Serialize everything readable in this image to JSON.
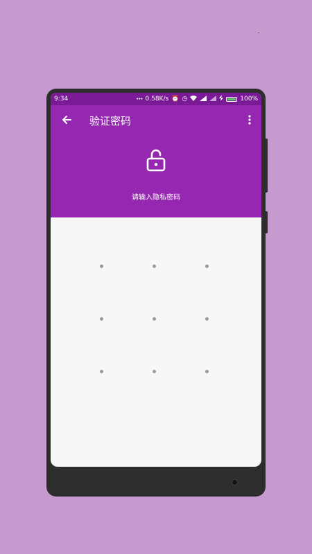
{
  "status_bar": {
    "time": "9:34",
    "net_speed": "0.58K/s",
    "battery_label": "100%",
    "battery_level": 1.0
  },
  "app_bar": {
    "title": "验证密码",
    "back_icon": "arrow-left-icon",
    "more_icon": "more-vert-icon"
  },
  "lock": {
    "icon": "unlock-icon",
    "prompt": "请输入隐私密码"
  },
  "pattern_dots": [
    {
      "row": 1,
      "col": 1
    },
    {
      "row": 1,
      "col": 2
    },
    {
      "row": 1,
      "col": 3
    },
    {
      "row": 2,
      "col": 1
    },
    {
      "row": 2,
      "col": 2
    },
    {
      "row": 2,
      "col": 3
    },
    {
      "row": 3,
      "col": 1
    },
    {
      "row": 3,
      "col": 2
    },
    {
      "row": 3,
      "col": 3
    }
  ],
  "colors": {
    "background": "#c69acf",
    "status_bar": "#7b1a96",
    "app_bar": "#9527b0",
    "pattern_area": "#f7f7f7",
    "dot": "#9a9a9a"
  }
}
